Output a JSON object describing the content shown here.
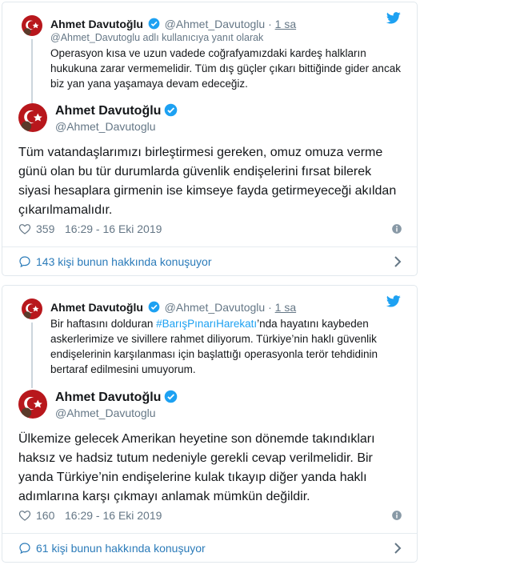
{
  "colors": {
    "brand_blue": "#1da1f2",
    "link_blue": "#2b7bb9",
    "muted_gray": "#657786",
    "text_dark": "#14171a",
    "avatar_red": "#b8171c",
    "border": "#e1e8ed"
  },
  "icons": {
    "brand": "twitter-bird-icon",
    "verified": "verified-badge-icon",
    "like": "heart-icon",
    "info": "info-icon",
    "conversation": "speech-bubble-icon",
    "more": "chevron-right-icon"
  },
  "tweets": [
    {
      "parent": {
        "name": "Ahmet Davutoğlu",
        "handle": "@Ahmet_Davutoglu",
        "separator": "·",
        "time": "1 sa",
        "reply_to": "@Ahmet_Davutoglu adlı kullanıcıya yanıt olarak",
        "text": "Operasyon kısa ve uzun vadede coğrafyamızdaki kardeş halkların hukukuna zarar vermemelidir. Tüm dış güçler çıkarı bittiğinde gider ancak biz yan yana yaşamaya devam edeceğiz."
      },
      "main": {
        "name": "Ahmet Davutoğlu",
        "handle": "@Ahmet_Davutoglu",
        "text": "Tüm vatandaşlarımızı birleştirmesi gereken, omuz omuza verme günü olan bu tür durumlarda güvenlik endişelerini fırsat bilerek siyasi hesaplara girmenin ise kimseye fayda getirmeyeceği akıldan çıkarılmamalıdır.",
        "likes": "359",
        "timestamp": "16:29 - 16 Eki 2019"
      },
      "conversation": "143 kişi bunun hakkında konuşuyor"
    },
    {
      "parent": {
        "name": "Ahmet Davutoğlu",
        "handle": "@Ahmet_Davutoglu",
        "separator": "·",
        "time": "1 sa",
        "text_before": "Bir haftasını dolduran ",
        "hashtag": "#BarışPınarıHarekatı",
        "text_after": "’nda hayatını kaybeden askerlerimize ve sivillere rahmet diliyorum. Türkiye’nin haklı güvenlik endişelerinin karşılanması için başlattığı operasyonla terör tehdidinin bertaraf edilmesini umuyorum."
      },
      "main": {
        "name": "Ahmet Davutoğlu",
        "handle": "@Ahmet_Davutoglu",
        "text": "Ülkemize gelecek Amerikan heyetine son dönemde takındıkları haksız ve hadsiz tutum nedeniyle gerekli cevap verilmelidir. Bir yanda Türkiye’nin endişelerine kulak tıkayıp diğer yanda haklı adımlarına karşı çıkmayı anlamak mümkün değildir.",
        "likes": "160",
        "timestamp": "16:29 - 16 Eki 2019"
      },
      "conversation": "61 kişi bunun hakkında konuşuyor"
    }
  ]
}
